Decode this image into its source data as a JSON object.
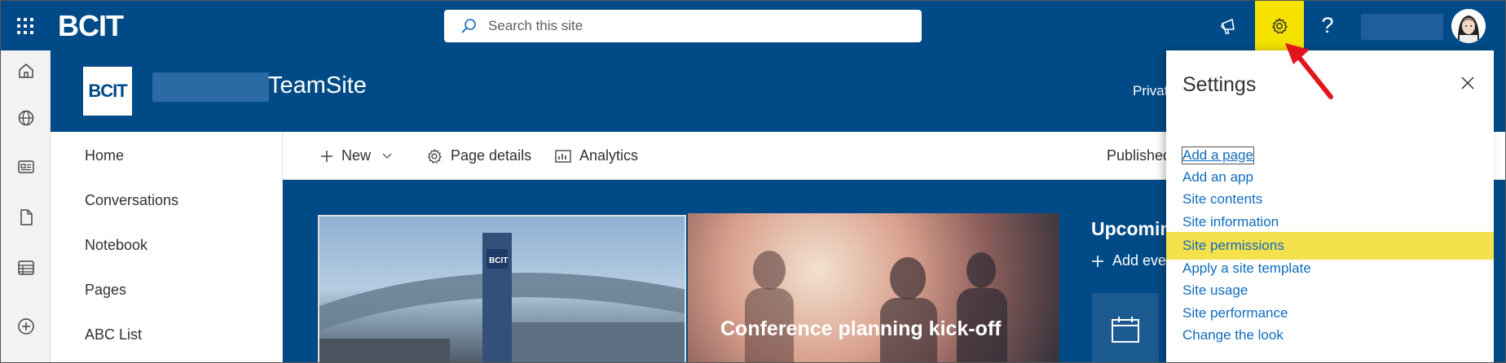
{
  "suitebar": {
    "brand": "BCIT",
    "search_placeholder": "Search this site",
    "help_label": "?",
    "colors": {
      "background": "#004b87",
      "gear_highlight": "#f5e200"
    }
  },
  "appbar": {
    "icons": [
      "home-icon",
      "globe-icon",
      "news-icon",
      "document-icon",
      "list-icon",
      "add-icon"
    ]
  },
  "site_header": {
    "logo_text": "BCIT",
    "title": "TeamSite",
    "privacy_truncated": "Privat"
  },
  "left_nav": {
    "items": [
      {
        "label": "Home"
      },
      {
        "label": "Conversations"
      },
      {
        "label": "Notebook"
      },
      {
        "label": "Pages"
      },
      {
        "label": "ABC List"
      }
    ]
  },
  "command_bar": {
    "new_label": "New",
    "page_details_label": "Page details",
    "analytics_label": "Analytics",
    "published_label": "Published"
  },
  "content": {
    "tile1_sign_text": "BCIT",
    "tile2_title": "Conference planning kick-off",
    "upcoming_label": "Upcomin",
    "add_event_label": "Add eve"
  },
  "settings": {
    "title": "Settings",
    "links": [
      {
        "label": "Add a page",
        "state": "focused"
      },
      {
        "label": "Add an app"
      },
      {
        "label": "Site contents"
      },
      {
        "label": "Site information"
      },
      {
        "label": "Site permissions",
        "state": "highlighted"
      },
      {
        "label": "Apply a site template"
      },
      {
        "label": "Site usage"
      },
      {
        "label": "Site performance"
      },
      {
        "label": "Change the look"
      }
    ],
    "colors": {
      "link": "#0f6cbd",
      "highlight": "#f5e14c"
    }
  }
}
